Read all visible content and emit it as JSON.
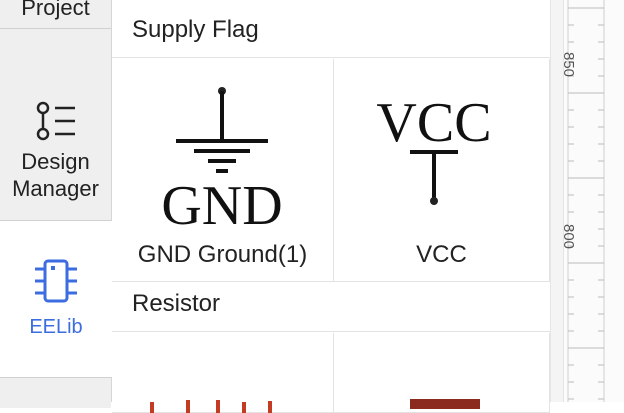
{
  "nav": {
    "project_label": "Project",
    "design_label_line1": "Design",
    "design_label_line2": "Manager",
    "eelib_label": "EELib",
    "accent_color": "#3c6de0"
  },
  "sections": {
    "supply_flag": "Supply Flag",
    "resistor": "Resistor"
  },
  "components": {
    "gnd": {
      "symbol_text": "GND",
      "label": "GND Ground(1)"
    },
    "vcc": {
      "symbol_text": "VCC",
      "label": "VCC"
    }
  },
  "ruler": {
    "label_top": "850",
    "label_bottom": "800"
  }
}
